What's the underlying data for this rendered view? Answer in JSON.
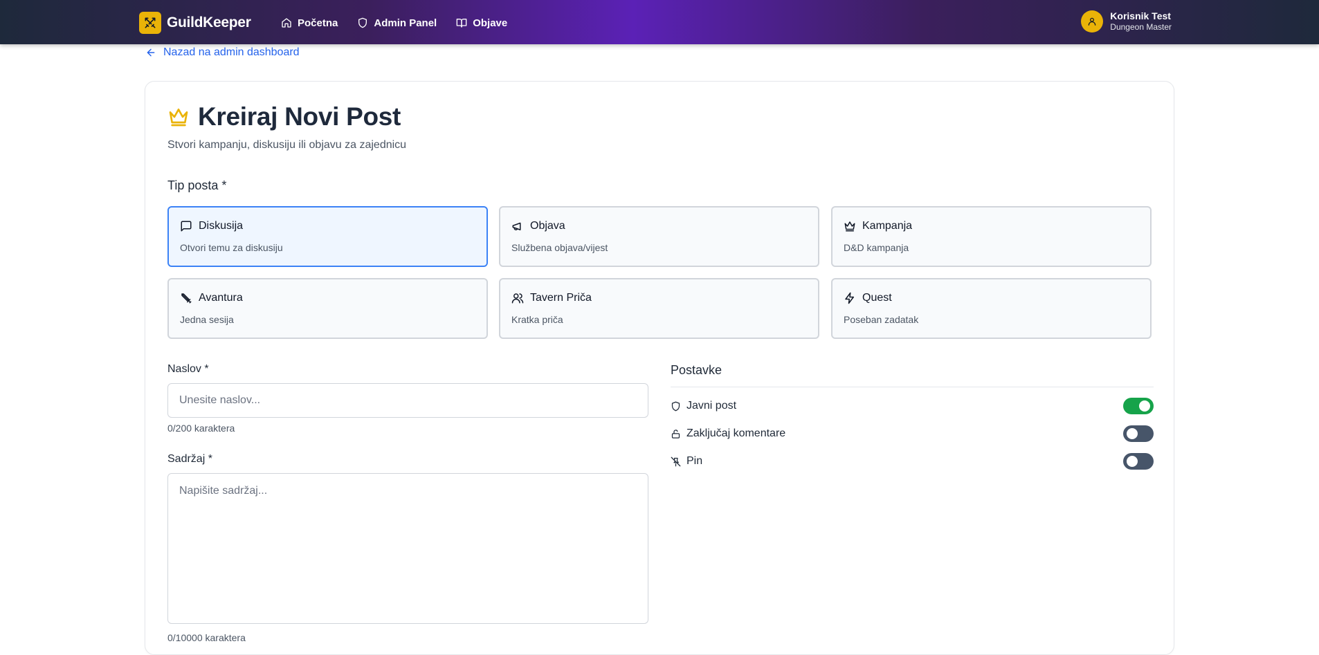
{
  "brand": {
    "name": "GuildKeeper",
    "accent": "#eab308"
  },
  "nav": {
    "links": [
      {
        "label": "Početna",
        "icon": "home-icon"
      },
      {
        "label": "Admin Panel",
        "icon": "shield-icon"
      },
      {
        "label": "Objave",
        "icon": "book-open-icon"
      }
    ]
  },
  "user": {
    "name": "Korisnik Test",
    "role": "Dungeon Master",
    "icon": "user-icon"
  },
  "back_link": "Nazad na admin dashboard",
  "page": {
    "title": "Kreiraj Novi Post",
    "subtitle": "Stvori kampanju, diskusiju ili objavu za zajednicu"
  },
  "post_type": {
    "label": "Tip posta *",
    "selected": "Diskusija",
    "options": [
      {
        "label": "Diskusija",
        "desc": "Otvori temu za diskusiju",
        "icon": "message-square-icon"
      },
      {
        "label": "Objava",
        "desc": "Službena objava/vijest",
        "icon": "megaphone-icon"
      },
      {
        "label": "Kampanja",
        "desc": "D&D kampanja",
        "icon": "crown-icon"
      },
      {
        "label": "Avantura",
        "desc": "Jedna sesija",
        "icon": "sword-icon"
      },
      {
        "label": "Tavern Priča",
        "desc": "Kratka priča",
        "icon": "users-icon"
      },
      {
        "label": "Quest",
        "desc": "Poseban zadatak",
        "icon": "zap-icon"
      }
    ]
  },
  "form": {
    "title_label": "Naslov *",
    "title_placeholder": "Unesite naslov...",
    "title_value": "",
    "title_counter": "0/200 karaktera",
    "content_label": "Sadržaj *",
    "content_placeholder": "Napišite sadržaj...",
    "content_value": "",
    "content_counter": "0/10000 karaktera"
  },
  "settings": {
    "title": "Postavke",
    "items": [
      {
        "label": "Javni post",
        "on": true,
        "icon": "shield-icon"
      },
      {
        "label": "Zaključaj komentare",
        "on": false,
        "icon": "unlock-icon"
      },
      {
        "label": "Pin",
        "on": false,
        "icon": "pin-off-icon"
      }
    ],
    "on_color": "#16a34a",
    "off_color": "#475569"
  }
}
